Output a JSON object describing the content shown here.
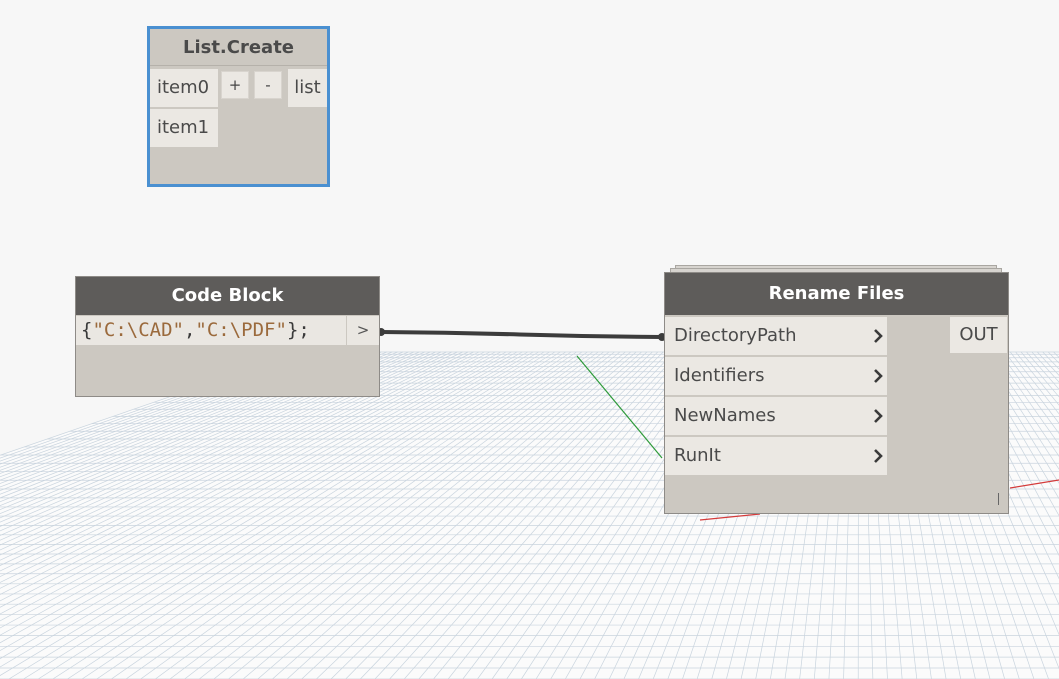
{
  "list_create": {
    "title": "List.Create",
    "inputs": [
      "item0",
      "item1"
    ],
    "add_label": "+",
    "remove_label": "-",
    "output": "list"
  },
  "code_block": {
    "title": "Code Block",
    "code": {
      "open": "{",
      "str1": "\"C:\\CAD\"",
      "comma": ",",
      "str2": "\"C:\\PDF\"",
      "close": "};"
    },
    "output": ">"
  },
  "rename_files": {
    "title": "Rename Files",
    "inputs": [
      "DirectoryPath",
      "Identifiers",
      "NewNames",
      "RunIt"
    ],
    "output": "OUT",
    "lacing": "l"
  },
  "colors": {
    "selection_border": "#4a90d1",
    "node_header": "#5e5c5a",
    "node_body": "#ccc8c1",
    "port": "#ebe8e3",
    "grid_line": "#c9d4de",
    "axis_green": "#2e9a3a",
    "axis_red": "#d43b3b"
  }
}
